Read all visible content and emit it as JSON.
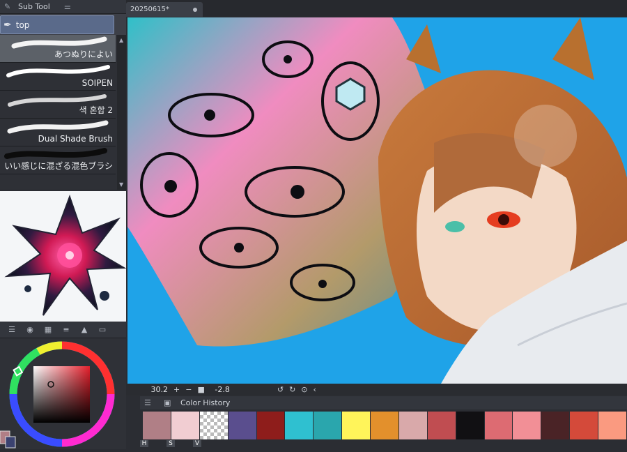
{
  "subtool": {
    "title": "Sub Tool",
    "group": "top"
  },
  "brushes": [
    {
      "name": "あつぬりによい",
      "selected": true
    },
    {
      "name": "SOIPEN",
      "selected": false
    },
    {
      "name": "색 혼합 2",
      "selected": false
    },
    {
      "name": "Dual Shade Brush",
      "selected": false
    },
    {
      "name": "いい感じに混ざる混色ブラシ",
      "selected": false
    }
  ],
  "document": {
    "tab_title": "20250615*"
  },
  "navigator": {
    "zoom": "30.2",
    "rotation": "-2.8"
  },
  "color_history": {
    "title": "Color History",
    "swatches": [
      "#b07f86",
      "#f1cdd2",
      "checker",
      "#5a4e8e",
      "#8e1d1b",
      "#2fc0d0",
      "#2aa6ad",
      "#fff45a",
      "#e3902c",
      "#d9a9aa",
      "#c04d51",
      "#111013",
      "#dd6b72",
      "#f28f96",
      "#4a2326",
      "#d44a3a",
      "#fa9a80"
    ]
  },
  "hsv_labels": [
    "H",
    "S",
    "V"
  ],
  "colors": {
    "canvas_bg": "#1fa3e8",
    "panel_bg": "#2b2d33",
    "selected_group": "#5a6a8a"
  }
}
